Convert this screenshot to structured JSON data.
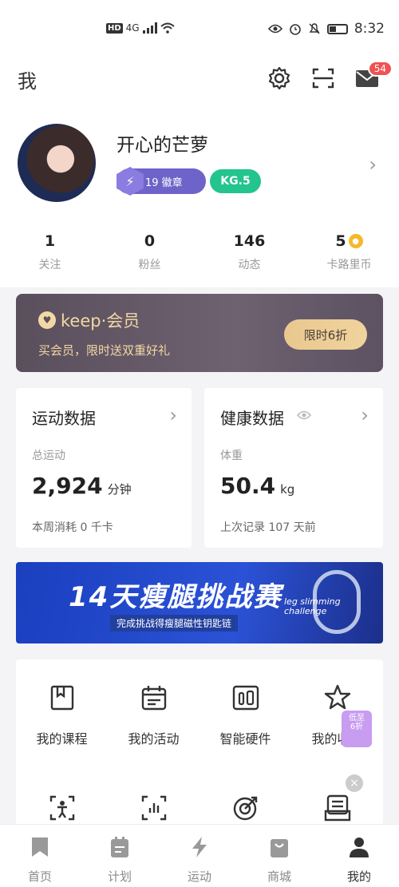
{
  "status_bar": {
    "network": "HD",
    "signal": "4G",
    "time": "8:32"
  },
  "header": {
    "title": "我",
    "unread_badge": "54"
  },
  "profile": {
    "username": "开心的芒萝",
    "medals": "19 徽章",
    "level": "KG.5",
    "stats": [
      {
        "value": "1",
        "label": "关注"
      },
      {
        "value": "0",
        "label": "粉丝"
      },
      {
        "value": "146",
        "label": "动态"
      },
      {
        "value": "5",
        "label": "卡路里币"
      }
    ]
  },
  "vip": {
    "logo": "keep·会员",
    "desc": "买会员，限时送双重好礼",
    "button": "限时6折"
  },
  "sport_card": {
    "title": "运动数据",
    "label": "总运动",
    "value": "2,924",
    "unit": "分钟",
    "footer": "本周消耗 0 千卡"
  },
  "health_card": {
    "title": "健康数据",
    "label": "体重",
    "value": "50.4",
    "unit": "kg",
    "footer": "上次记录 107 天前"
  },
  "banner": {
    "title": "14天瘦腿挑战赛",
    "subtitle": "完成挑战得瘦腿磁性钥匙链",
    "en_line1": "leg slimming",
    "en_line2": "challenge"
  },
  "tools": [
    {
      "label": "我的课程",
      "icon": "bookmark-icon"
    },
    {
      "label": "我的活动",
      "icon": "calendar-icon"
    },
    {
      "label": "智能硬件",
      "icon": "device-icon"
    },
    {
      "label": "我的收藏",
      "icon": "star-icon"
    }
  ],
  "promo": {
    "line1": "低至",
    "line2": "6折"
  },
  "tabs": [
    {
      "label": "首页",
      "icon": "home-bookmark-icon"
    },
    {
      "label": "计划",
      "icon": "plan-icon"
    },
    {
      "label": "运动",
      "icon": "bolt-icon"
    },
    {
      "label": "商城",
      "icon": "shop-icon"
    },
    {
      "label": "我的",
      "icon": "person-icon",
      "active": true
    }
  ]
}
